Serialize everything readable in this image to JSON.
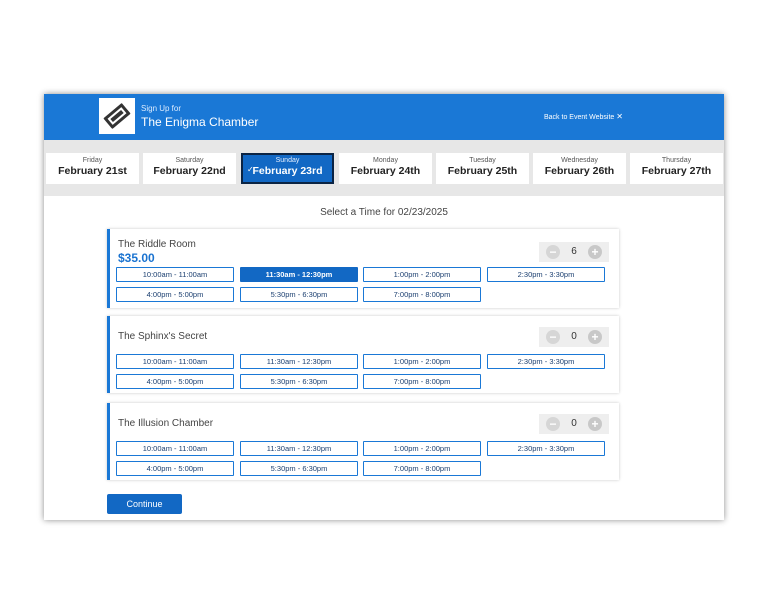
{
  "header": {
    "signup_label": "Sign Up for",
    "event_title": "The Enigma Chamber",
    "back_link": "Back to Event Website",
    "close_glyph": "✕"
  },
  "dates": [
    {
      "dow": "Friday",
      "date": "February 21st",
      "selected": false
    },
    {
      "dow": "Saturday",
      "date": "February 22nd",
      "selected": false
    },
    {
      "dow": "Sunday",
      "date": "February 23rd",
      "selected": true
    },
    {
      "dow": "Monday",
      "date": "February 24th",
      "selected": false
    },
    {
      "dow": "Tuesday",
      "date": "February 25th",
      "selected": false
    },
    {
      "dow": "Wednesday",
      "date": "February 26th",
      "selected": false
    },
    {
      "dow": "Thursday",
      "date": "February 27th",
      "selected": false
    }
  ],
  "select_time_label": "Select a Time for 02/23/2025",
  "rooms": [
    {
      "name": "The Riddle Room",
      "price": "$35.00",
      "quantity": "6",
      "slots": [
        "10:00am - 11:00am",
        "11:30am - 12:30pm",
        "1:00pm - 2:00pm",
        "2:30pm - 3:30pm",
        "4:00pm - 5:00pm",
        "5:30pm - 6:30pm",
        "7:00pm - 8:00pm"
      ],
      "selected_slot": "11:30am - 12:30pm"
    },
    {
      "name": "The Sphinx's Secret",
      "price": "",
      "quantity": "0",
      "slots": [
        "10:00am - 11:00am",
        "11:30am - 12:30pm",
        "1:00pm - 2:00pm",
        "2:30pm - 3:30pm",
        "4:00pm - 5:00pm",
        "5:30pm - 6:30pm",
        "7:00pm - 8:00pm"
      ],
      "selected_slot": ""
    },
    {
      "name": "The Illusion Chamber",
      "price": "",
      "quantity": "0",
      "slots": [
        "10:00am - 11:00am",
        "11:30am - 12:30pm",
        "1:00pm - 2:00pm",
        "2:30pm - 3:30pm",
        "4:00pm - 5:00pm",
        "5:30pm - 6:30pm",
        "7:00pm - 8:00pm"
      ],
      "selected_slot": ""
    }
  ],
  "continue_label": "Continue",
  "icons": {
    "logo": "ticket-icon",
    "check": "checkmark-icon",
    "minus": "minus-icon",
    "plus": "plus-icon"
  },
  "colors": {
    "primary": "#1a78d6",
    "selected": "#1268c4",
    "price": "#1a73d0"
  }
}
